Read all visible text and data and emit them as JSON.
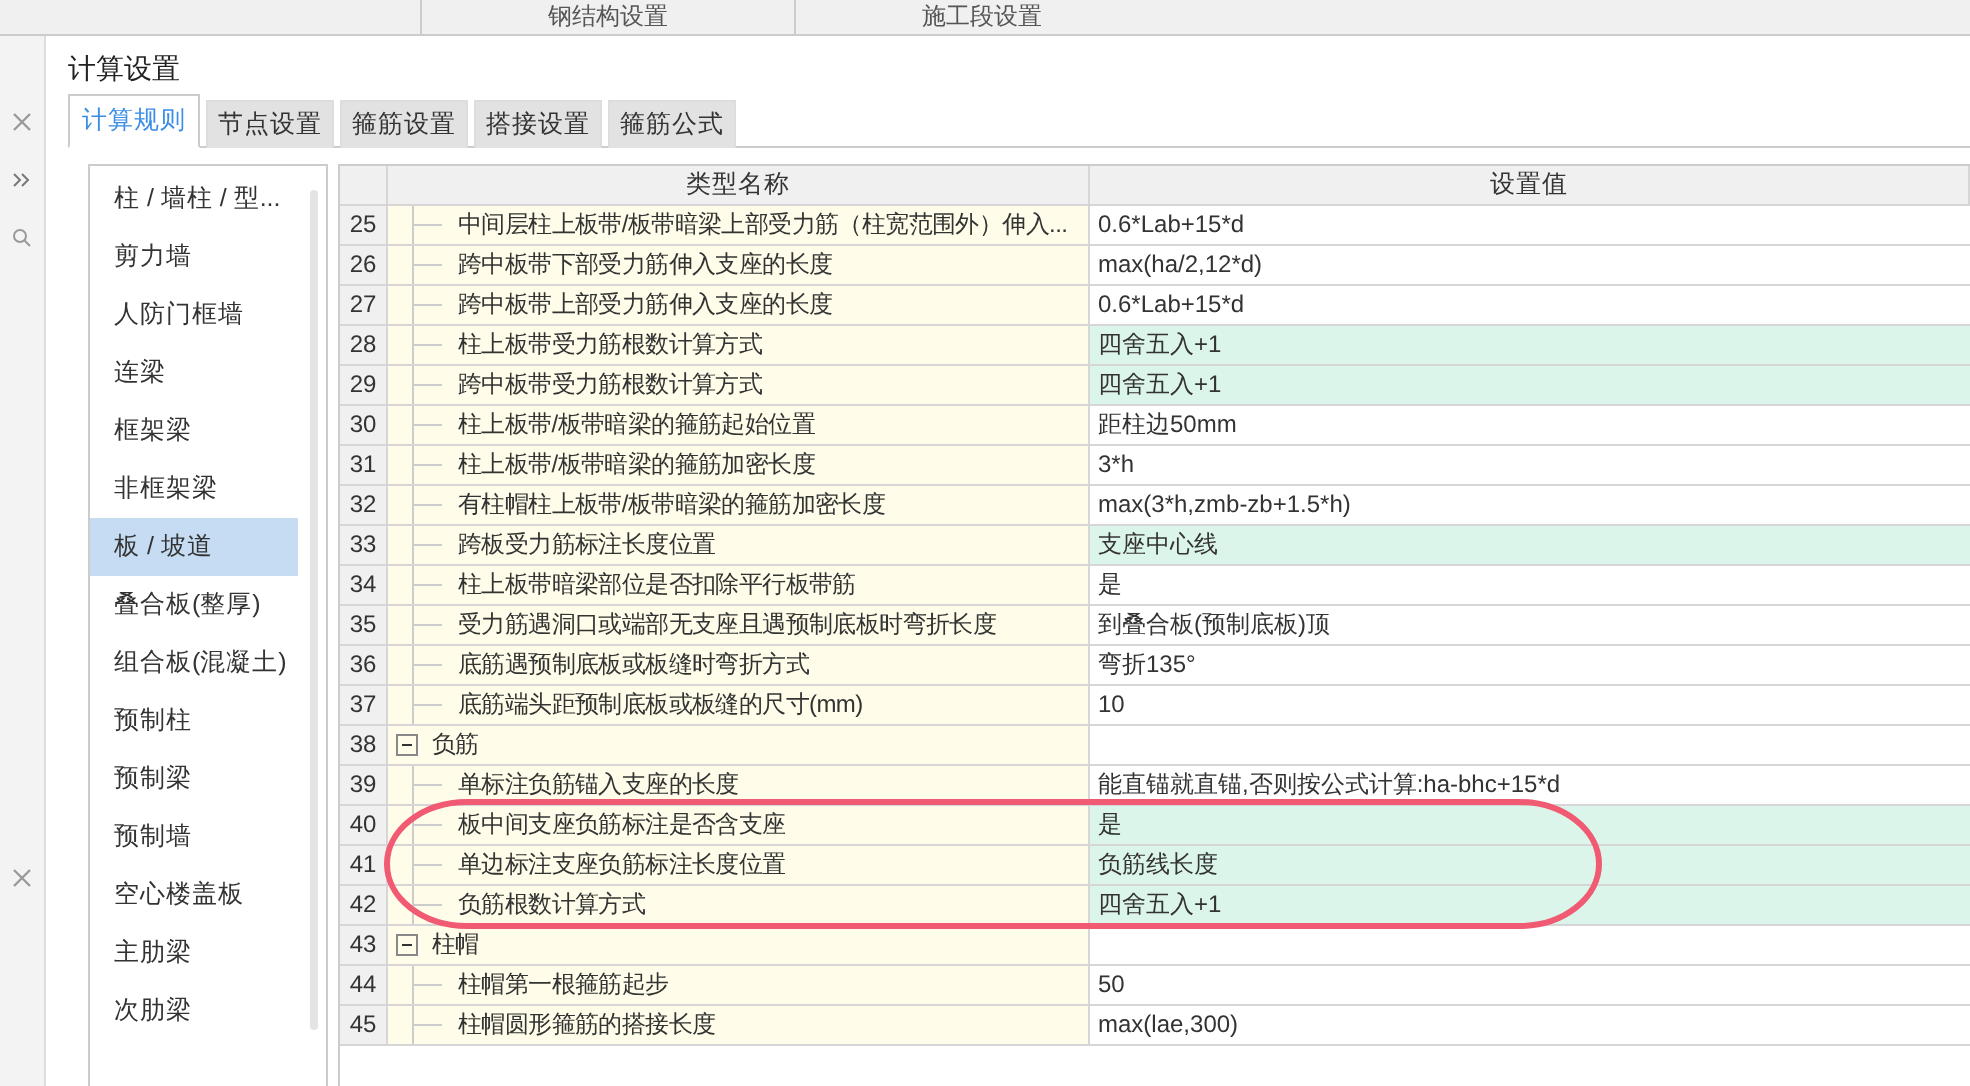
{
  "background_tabs": [
    "钢结构设置",
    "施工段设置"
  ],
  "window": {
    "title": "计算设置"
  },
  "tabs": [
    {
      "label": "计算规则",
      "selected": true
    },
    {
      "label": "节点设置",
      "selected": false
    },
    {
      "label": "箍筋设置",
      "selected": false
    },
    {
      "label": "搭接设置",
      "selected": false
    },
    {
      "label": "箍筋公式",
      "selected": false
    }
  ],
  "sidebar": {
    "items": [
      {
        "label": "柱 / 墙柱 / 型...",
        "selected": false
      },
      {
        "label": "剪力墙",
        "selected": false
      },
      {
        "label": "人防门框墙",
        "selected": false
      },
      {
        "label": "连梁",
        "selected": false
      },
      {
        "label": "框架梁",
        "selected": false
      },
      {
        "label": "非框架梁",
        "selected": false
      },
      {
        "label": "板 / 坡道",
        "selected": true
      },
      {
        "label": "叠合板(整厚)",
        "selected": false
      },
      {
        "label": "组合板(混凝土)",
        "selected": false
      },
      {
        "label": "预制柱",
        "selected": false
      },
      {
        "label": "预制梁",
        "selected": false
      },
      {
        "label": "预制墙",
        "selected": false
      },
      {
        "label": "空心楼盖板",
        "selected": false
      },
      {
        "label": "主肋梁",
        "selected": false
      },
      {
        "label": "次肋梁",
        "selected": false
      }
    ]
  },
  "table": {
    "columns": [
      "类型名称",
      "设置值"
    ],
    "rows": [
      {
        "kind": "item",
        "no": "25",
        "name": "中间层柱上板带/板带暗梁上部受力筋（柱宽范围外）伸入...",
        "value": "0.6*Lab+15*d",
        "highlighted": false
      },
      {
        "kind": "item",
        "no": "26",
        "name": "跨中板带下部受力筋伸入支座的长度",
        "value": "max(ha/2,12*d)",
        "highlighted": false
      },
      {
        "kind": "item",
        "no": "27",
        "name": "跨中板带上部受力筋伸入支座的长度",
        "value": "0.6*Lab+15*d",
        "highlighted": false
      },
      {
        "kind": "item",
        "no": "28",
        "name": "柱上板带受力筋根数计算方式",
        "value": "四舍五入+1",
        "highlighted": true
      },
      {
        "kind": "item",
        "no": "29",
        "name": "跨中板带受力筋根数计算方式",
        "value": "四舍五入+1",
        "highlighted": true
      },
      {
        "kind": "item",
        "no": "30",
        "name": "柱上板带/板带暗梁的箍筋起始位置",
        "value": "距柱边50mm",
        "highlighted": false
      },
      {
        "kind": "item",
        "no": "31",
        "name": "柱上板带/板带暗梁的箍筋加密长度",
        "value": "3*h",
        "highlighted": false
      },
      {
        "kind": "item",
        "no": "32",
        "name": "有柱帽柱上板带/板带暗梁的箍筋加密长度",
        "value": "max(3*h,zmb-zb+1.5*h)",
        "highlighted": false
      },
      {
        "kind": "item",
        "no": "33",
        "name": "跨板受力筋标注长度位置",
        "value": "支座中心线",
        "highlighted": true
      },
      {
        "kind": "item",
        "no": "34",
        "name": "柱上板带暗梁部位是否扣除平行板带筋",
        "value": "是",
        "highlighted": false
      },
      {
        "kind": "item",
        "no": "35",
        "name": "受力筋遇洞口或端部无支座且遇预制底板时弯折长度",
        "value": "到叠合板(预制底板)顶",
        "highlighted": false
      },
      {
        "kind": "item",
        "no": "36",
        "name": "底筋遇预制底板或板缝时弯折方式",
        "value": "弯折135°",
        "highlighted": false
      },
      {
        "kind": "item",
        "no": "37",
        "name": "底筋端头距预制底板或板缝的尺寸(mm)",
        "value": "10",
        "highlighted": false
      },
      {
        "kind": "group",
        "no": "38",
        "name": "负筋",
        "expanded": true
      },
      {
        "kind": "item",
        "no": "39",
        "name": "单标注负筋锚入支座的长度",
        "value": "能直锚就直锚,否则按公式计算:ha-bhc+15*d",
        "highlighted": false
      },
      {
        "kind": "item",
        "no": "40",
        "name": "板中间支座负筋标注是否含支座",
        "value": "是",
        "highlighted": true
      },
      {
        "kind": "item",
        "no": "41",
        "name": "单边标注支座负筋标注长度位置",
        "value": "负筋线长度",
        "highlighted": true
      },
      {
        "kind": "item",
        "no": "42",
        "name": "负筋根数计算方式",
        "value": "四舍五入+1",
        "highlighted": true
      },
      {
        "kind": "group",
        "no": "43",
        "name": "柱帽",
        "expanded": true
      },
      {
        "kind": "item",
        "no": "44",
        "name": "柱帽第一根箍筋起步",
        "value": "50",
        "highlighted": false
      },
      {
        "kind": "item",
        "no": "45",
        "name": "柱帽圆形箍筋的搭接长度",
        "value": "max(lae,300)",
        "highlighted": false
      }
    ]
  }
}
